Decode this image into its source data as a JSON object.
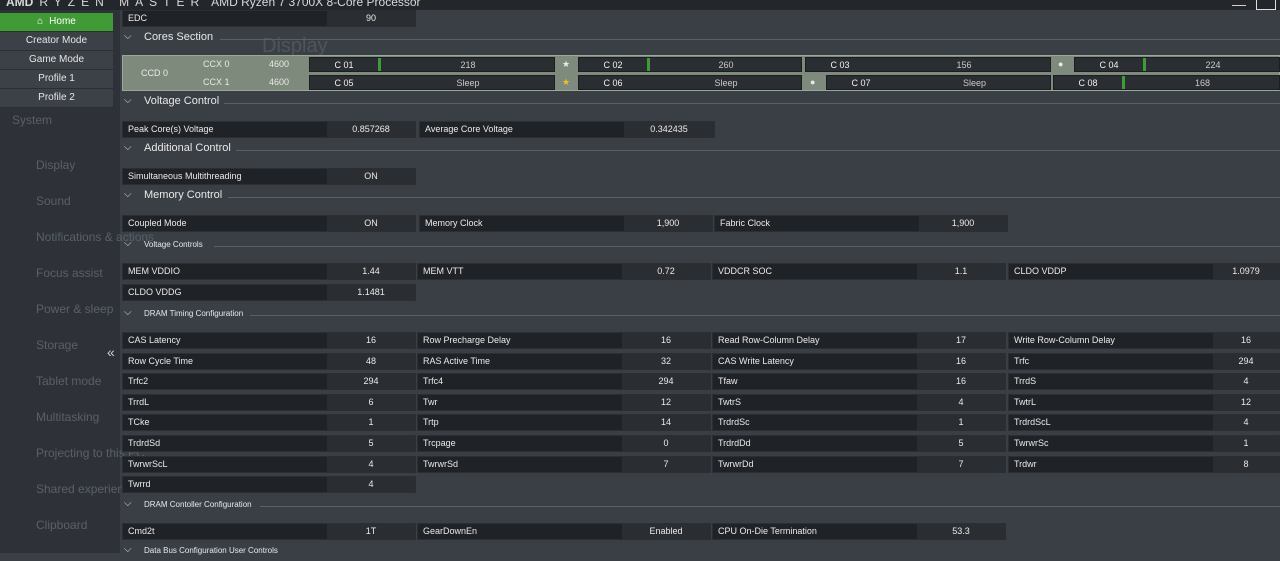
{
  "app": {
    "brand": "AMD",
    "product": "RYZEN MASTER",
    "processor": "AMD Ryzen 7 3700X 8-Core Processor",
    "minimize": "—"
  },
  "nav": {
    "items": [
      "Home",
      "Creator Mode",
      "Game Mode",
      "Profile 1",
      "Profile 2"
    ],
    "active": "Home",
    "collapse_glyph": "«"
  },
  "background_window": {
    "title": "Display",
    "sidebar": [
      "System",
      "Display",
      "Sound",
      "Notifications & actions",
      "Focus assist",
      "Power & sleep",
      "Storage",
      "Tablet mode",
      "Multitasking",
      "Projecting to this PC",
      "Shared experiences",
      "Clipboard"
    ]
  },
  "edc": {
    "label": "EDC",
    "value": "90"
  },
  "sections": {
    "cores": "Cores Section",
    "voltage": "Voltage Control",
    "additional": "Additional Control",
    "memory": "Memory Control",
    "voltage_controls": "Voltage Controls",
    "dram_timing": "DRAM Timing Configuration",
    "dram_controller": "DRAM Contoller Configuration",
    "data_bus": "Data Bus Configuration User Controls"
  },
  "cores": {
    "ccd": "CCD 0",
    "ccx": [
      {
        "label": "CCX 0",
        "freq": "4600"
      },
      {
        "label": "CCX 1",
        "freq": "4600"
      }
    ],
    "items": [
      {
        "name": "C 01",
        "value": "218",
        "marker": ""
      },
      {
        "name": "C 02",
        "value": "260",
        "marker": "★"
      },
      {
        "name": "C 03",
        "value": "156",
        "marker": ""
      },
      {
        "name": "C 04",
        "value": "224",
        "marker": "●"
      },
      {
        "name": "C 05",
        "value": "Sleep",
        "marker": ""
      },
      {
        "name": "C 06",
        "value": "Sleep",
        "marker": "★"
      },
      {
        "name": "C 07",
        "value": "Sleep",
        "marker": "●"
      },
      {
        "name": "C 08",
        "value": "168",
        "marker": ""
      }
    ],
    "best_core_color": "#f0c419",
    "activity_color": "#3d9c35"
  },
  "voltage": {
    "peak_label": "Peak Core(s) Voltage",
    "peak_value": "0.857268",
    "avg_label": "Average Core Voltage",
    "avg_value": "0.342435"
  },
  "additional": {
    "smt_label": "Simultaneous Multithreading",
    "smt_value": "ON"
  },
  "memory": {
    "coupled_label": "Coupled Mode",
    "coupled_value": "ON",
    "mclk_label": "Memory Clock",
    "mclk_value": "1,900",
    "fclk_label": "Fabric Clock",
    "fclk_value": "1,900"
  },
  "voltage_controls": [
    {
      "label": "MEM VDDIO",
      "value": "1.44"
    },
    {
      "label": "MEM VTT",
      "value": "0.72"
    },
    {
      "label": "VDDCR SOC",
      "value": "1.1"
    },
    {
      "label": "CLDO VDDP",
      "value": "1.0979"
    },
    {
      "label": "CLDO VDDG",
      "value": "1.1481"
    }
  ],
  "dram_timing": [
    {
      "label": "CAS Latency",
      "value": "16"
    },
    {
      "label": "Row Precharge Delay",
      "value": "16"
    },
    {
      "label": "Read Row-Column Delay",
      "value": "17"
    },
    {
      "label": "Write Row-Column Delay",
      "value": "16"
    },
    {
      "label": "Row Cycle Time",
      "value": "48"
    },
    {
      "label": "RAS Active Time",
      "value": "32"
    },
    {
      "label": "CAS Write Latency",
      "value": "16"
    },
    {
      "label": "Trfc",
      "value": "294"
    },
    {
      "label": "Trfc2",
      "value": "294"
    },
    {
      "label": "Trfc4",
      "value": "294"
    },
    {
      "label": "Tfaw",
      "value": "16"
    },
    {
      "label": "TrrdS",
      "value": "4"
    },
    {
      "label": "TrrdL",
      "value": "6"
    },
    {
      "label": "Twr",
      "value": "12"
    },
    {
      "label": "TwtrS",
      "value": "4"
    },
    {
      "label": "TwtrL",
      "value": "12"
    },
    {
      "label": "TCke",
      "value": "1"
    },
    {
      "label": "Trtp",
      "value": "14"
    },
    {
      "label": "TrdrdSc",
      "value": "1"
    },
    {
      "label": "TrdrdScL",
      "value": "4"
    },
    {
      "label": "TrdrdSd",
      "value": "5"
    },
    {
      "label": "Trcpage",
      "value": "0"
    },
    {
      "label": "TrdrdDd",
      "value": "5"
    },
    {
      "label": "TwrwrSc",
      "value": "1"
    },
    {
      "label": "TwrwrScL",
      "value": "4"
    },
    {
      "label": "TwrwrSd",
      "value": "7"
    },
    {
      "label": "TwrwrDd",
      "value": "7"
    },
    {
      "label": "Trdwr",
      "value": "8"
    },
    {
      "label": "Twrrd",
      "value": "4"
    }
  ],
  "dram_controller": [
    {
      "label": "Cmd2t",
      "value": "1T"
    },
    {
      "label": "GearDownEn",
      "value": "Enabled"
    },
    {
      "label": "CPU On-Die Termination",
      "value": "53.3"
    }
  ]
}
